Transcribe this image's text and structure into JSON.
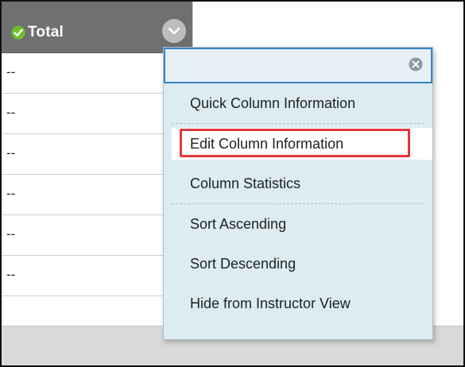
{
  "column": {
    "title": "Total",
    "cells": [
      "--",
      "--",
      "--",
      "--",
      "--",
      "--"
    ]
  },
  "menu": {
    "items": {
      "quick": "Quick Column Information",
      "edit": "Edit Column Information",
      "stats": "Column Statistics",
      "sort_asc": "Sort Ascending",
      "sort_desc": "Sort Descending",
      "hide": "Hide from Instructor View"
    }
  },
  "colors": {
    "header_bg": "#707070",
    "menu_bg": "#dcecf1",
    "highlight_border": "#e0383b",
    "focus_border": "#3a83c7",
    "check_green": "#6cbf2f"
  },
  "icons": {
    "header_check": "check-icon",
    "header_menu": "chevron-down-icon",
    "close": "close-icon"
  }
}
